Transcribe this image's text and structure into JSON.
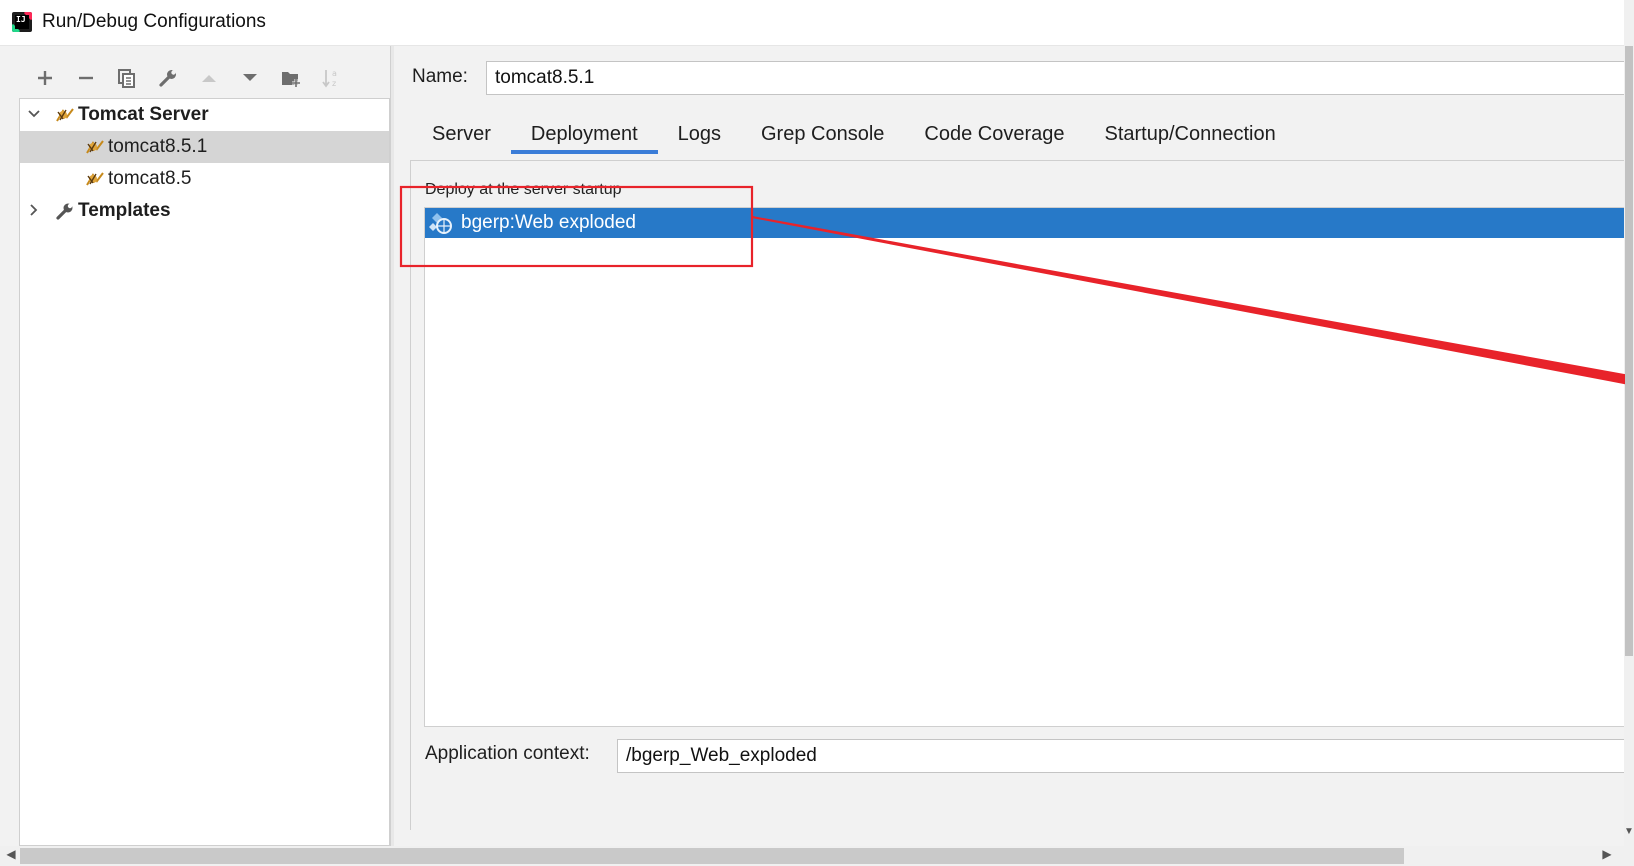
{
  "window": {
    "title": "Run/Debug Configurations",
    "app_icon": "intellij-idea-icon"
  },
  "toolbar": {
    "buttons": [
      {
        "name": "add",
        "icon": "plus-icon",
        "enabled": true
      },
      {
        "name": "remove",
        "icon": "minus-icon",
        "enabled": true
      },
      {
        "name": "copy",
        "icon": "copy-icon",
        "enabled": true
      },
      {
        "name": "edit-defaults",
        "icon": "wrench-icon",
        "enabled": true
      },
      {
        "name": "move-up",
        "icon": "arrow-up-icon",
        "enabled": false
      },
      {
        "name": "move-down",
        "icon": "arrow-down-icon",
        "enabled": true
      },
      {
        "name": "new-folder",
        "icon": "folder-add-icon",
        "enabled": true
      },
      {
        "name": "sort",
        "icon": "sort-alpha-icon",
        "enabled": false
      }
    ]
  },
  "tree": {
    "groups": [
      {
        "label": "Tomcat Server",
        "expanded": true,
        "icon": "tomcat-icon",
        "children": [
          {
            "label": "tomcat8.5.1",
            "selected": true,
            "icon": "tomcat-icon"
          },
          {
            "label": "tomcat8.5",
            "selected": false,
            "icon": "tomcat-icon"
          }
        ]
      },
      {
        "label": "Templates",
        "expanded": false,
        "icon": "wrench-icon",
        "children": []
      }
    ]
  },
  "config": {
    "name_label": "Name:",
    "name_value": "tomcat8.5.1",
    "tabs": [
      {
        "label": "Server",
        "active": false
      },
      {
        "label": "Deployment",
        "active": true
      },
      {
        "label": "Logs",
        "active": false
      },
      {
        "label": "Grep Console",
        "active": false
      },
      {
        "label": "Code Coverage",
        "active": false
      },
      {
        "label": "Startup/Connection",
        "active": false
      }
    ],
    "deployment": {
      "section_title": "Deploy at the server startup",
      "artifacts": [
        {
          "label": "bgerp:Web exploded",
          "selected": true,
          "icon": "web-artifact-icon"
        }
      ],
      "app_context_label": "Application context:",
      "app_context_value": "/bgerp_Web_exploded"
    }
  },
  "colors": {
    "selection_blue": "#2779c8",
    "tab_underline": "#3b7dd8",
    "annotation_red": "#e8232a",
    "panel_bg": "#f2f2f2"
  }
}
